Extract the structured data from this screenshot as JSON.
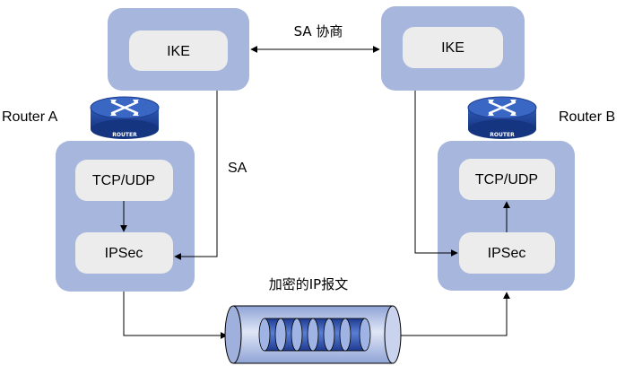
{
  "router_a": {
    "name": "Router A",
    "badge": "ROUTER",
    "ike_label": "IKE",
    "upper_label": "TCP/UDP",
    "lower_label": "IPSec"
  },
  "router_b": {
    "name": "Router B",
    "badge": "ROUTER",
    "ike_label": "IKE",
    "upper_label": "TCP/UDP",
    "lower_label": "IPSec"
  },
  "links": {
    "sa_negotiation": "SA  协商",
    "sa": "SA",
    "encrypted_packet": "加密的IP报文"
  },
  "colors": {
    "panel": "#a7b6dc",
    "box": "#ececec",
    "router_dark": "#1d3f91",
    "router_mid": "#2f5bb8",
    "tube": "#b5c2e3",
    "packet": "#2b4db2"
  }
}
